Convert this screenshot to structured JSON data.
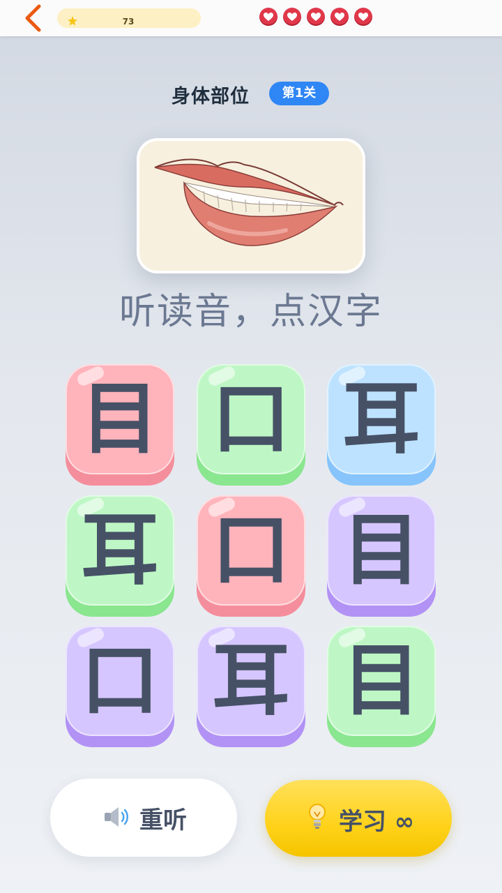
{
  "topbar": {
    "coins": "73",
    "lives": 5,
    "accent": "#e0384a"
  },
  "header": {
    "category": "身体部位",
    "level": "第1关"
  },
  "picture": {
    "icon": "lips-smile-illustration"
  },
  "instruction": "听读音，点汉字",
  "tiles": [
    {
      "char": "目",
      "color": "pink"
    },
    {
      "char": "口",
      "color": "green"
    },
    {
      "char": "耳",
      "color": "blue"
    },
    {
      "char": "耳",
      "color": "green"
    },
    {
      "char": "口",
      "color": "pink"
    },
    {
      "char": "目",
      "color": "purple"
    },
    {
      "char": "口",
      "color": "purple"
    },
    {
      "char": "耳",
      "color": "purple"
    },
    {
      "char": "目",
      "color": "green"
    }
  ],
  "actions": {
    "replay_label": "重听",
    "learn_label": "学习 ∞"
  },
  "colors": {
    "level_badge": "#2f86f5",
    "learn_button": "#ffd21a",
    "text_dark": "#465166"
  }
}
